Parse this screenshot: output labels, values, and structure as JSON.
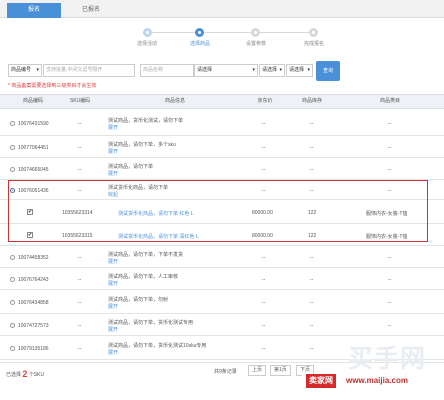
{
  "tabs": {
    "active": "报名",
    "inactive": "已报名"
  },
  "steps": [
    {
      "label": "选择活动",
      "state": "done"
    },
    {
      "label": "选择商品",
      "state": "active"
    },
    {
      "label": "设置参数",
      "state": "todo"
    },
    {
      "label": "完成报名",
      "state": "todo"
    }
  ],
  "filter": {
    "field_select": "商品编号",
    "search_placeholder": "支持批量,中间文逗号隔开",
    "name_placeholder": "商品名称",
    "select1": "请选择",
    "select2": "请选择",
    "select3": "请选择",
    "query_label": "查询"
  },
  "notice": "* 商品备案需要选择到三级类目才会生效",
  "table": {
    "headers": [
      "商品编码",
      "SKU编码",
      "商品信息",
      "京东价",
      "商品库存",
      "商品类目"
    ],
    "rows": [
      {
        "code": "10076431590",
        "sku": "--",
        "info": "测试商品，货币化测试，请勿下单",
        "action": "展开",
        "price": "--",
        "stock": "--",
        "category": "--"
      },
      {
        "code": "10077064451",
        "sku": "--",
        "info": "测试商品，请勿下单，多个sku",
        "action": "展开",
        "price": "--",
        "stock": "--",
        "category": "--"
      },
      {
        "code": "10074665045",
        "sku": "--",
        "info": "测试商品，请勿下单",
        "action": "展开",
        "price": "--",
        "stock": "--",
        "category": "--"
      },
      {
        "code": "10076051436",
        "sku": "--",
        "info": "测试货币化商品，请勿下单",
        "action": "收起",
        "price": "--",
        "stock": "--",
        "category": "--",
        "selected": true
      },
      {
        "code": "",
        "sku": "10355623314",
        "info": "测试货币化商品，请勿下单 红色 L",
        "price": "80000.00",
        "stock": "122",
        "category": "服饰内衣-女装-T恤",
        "sub": true
      },
      {
        "code": "",
        "sku": "10355623315",
        "info": "测试货币化商品，请勿下单 深红色 L",
        "price": "80000.00",
        "stock": "122",
        "category": "服饰内衣-女装-T恤",
        "sub": true
      },
      {
        "code": "10074458352",
        "sku": "--",
        "info": "测试商品，请勿下单，下单不发货",
        "action": "展开",
        "price": "--",
        "stock": "--",
        "category": "--"
      },
      {
        "code": "10076764243",
        "sku": "--",
        "info": "测试商品，请勿下单，人工审核",
        "action": "展开",
        "price": "--",
        "stock": "--",
        "category": "--"
      },
      {
        "code": "10076434858",
        "sku": "--",
        "info": "测试商品，请勿下单，勿射",
        "action": "展开",
        "price": "--",
        "stock": "--",
        "category": "--"
      },
      {
        "code": "10074727573",
        "sku": "--",
        "info": "测试商品，请勿下单，货币化测试专用",
        "action": "展开",
        "price": "--",
        "stock": "--",
        "category": "--"
      },
      {
        "code": "10079135186",
        "sku": "--",
        "info": "测试商品，请勿下单，货币化测试10sku专用",
        "action": "展开",
        "price": "--",
        "stock": "--",
        "category": "--"
      }
    ]
  },
  "footer": {
    "selected_prefix": "已选择",
    "selected_count": "2",
    "selected_suffix": "个SKU",
    "total_text": "共9条记录",
    "prev": "上页",
    "page_info": "第1页",
    "next": "下页"
  },
  "watermark": {
    "logo": "买手网",
    "badge": "卖家网",
    "url": "www.maijia.com"
  }
}
